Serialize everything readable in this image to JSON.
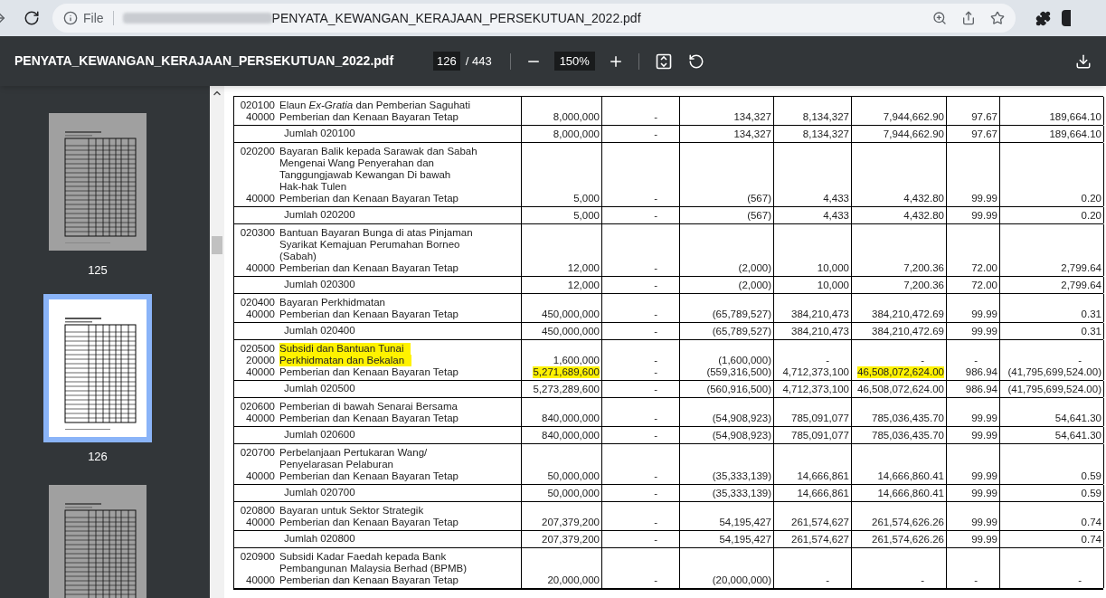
{
  "browser": {
    "scheme": "File",
    "file_name": "PENYATA_KEWANGAN_KERAJAAN_PERSEKUTUAN_2022.pdf"
  },
  "pdf_toolbar": {
    "title": "PENYATA_KEWANGAN_KERAJAAN_PERSEKUTUAN_2022.pdf",
    "page": "126",
    "page_count": "/ 443",
    "zoom": "150%"
  },
  "thumbnails": [
    {
      "label": "125",
      "selected": false
    },
    {
      "label": "126",
      "selected": true
    },
    {
      "selected": false
    }
  ],
  "groups": [
    {
      "rows": [
        {
          "code": "020100",
          "lines": [
            "Elaun *Ex-Gratia* dan Pemberian Saguhati"
          ],
          "highlighted": false
        },
        {
          "code": "40000",
          "lines": [
            "Pemberian dan Kenaan Bayaran Tetap"
          ],
          "highlighted": false,
          "values": [
            "8,000,000",
            "-",
            "134,327",
            "8,134,327",
            "7,944,662.90",
            "97.67",
            "189,664.10"
          ],
          "cell_highlights": [
            false,
            false,
            false,
            false,
            false,
            false,
            false
          ]
        }
      ],
      "total": {
        "label": "Jumlah 020100",
        "values": [
          "8,000,000",
          "-",
          "134,327",
          "8,134,327",
          "7,944,662.90",
          "97.67",
          "189,664.10"
        ]
      }
    },
    {
      "rows": [
        {
          "code": "020200",
          "lines": [
            "Bayaran Balik kepada Sarawak dan Sabah",
            "Mengenai Wang Penyerahan dan",
            "Tanggungjawab Kewangan Di bawah",
            "Hak-hak Tulen"
          ],
          "highlighted": false
        },
        {
          "code": "40000",
          "lines": [
            "Pemberian dan Kenaan Bayaran Tetap"
          ],
          "highlighted": false,
          "values": [
            "5,000",
            "-",
            "(567)",
            "4,433",
            "4,432.80",
            "99.99",
            "0.20"
          ],
          "cell_highlights": [
            false,
            false,
            false,
            false,
            false,
            false,
            false
          ]
        }
      ],
      "total": {
        "label": "Jumlah 020200",
        "values": [
          "5,000",
          "-",
          "(567)",
          "4,433",
          "4,432.80",
          "99.99",
          "0.20"
        ]
      }
    },
    {
      "rows": [
        {
          "code": "020300",
          "lines": [
            "Bantuan Bayaran Bunga di atas Pinjaman",
            "Syarikat Kemajuan Perumahan Borneo",
            "(Sabah)"
          ],
          "highlighted": false
        },
        {
          "code": "40000",
          "lines": [
            "Pemberian dan Kenaan Bayaran Tetap"
          ],
          "highlighted": false,
          "values": [
            "12,000",
            "-",
            "(2,000)",
            "10,000",
            "7,200.36",
            "72.00",
            "2,799.64"
          ],
          "cell_highlights": [
            false,
            false,
            false,
            false,
            false,
            false,
            false
          ]
        }
      ],
      "total": {
        "label": "Jumlah 020300",
        "values": [
          "12,000",
          "-",
          "(2,000)",
          "10,000",
          "7,200.36",
          "72.00",
          "2,799.64"
        ]
      }
    },
    {
      "rows": [
        {
          "code": "020400",
          "lines": [
            "Bayaran Perkhidmatan"
          ],
          "highlighted": false
        },
        {
          "code": "40000",
          "lines": [
            "Pemberian dan Kenaan Bayaran Tetap"
          ],
          "highlighted": false,
          "values": [
            "450,000,000",
            "-",
            "(65,789,527)",
            "384,210,473",
            "384,210,472.69",
            "99.99",
            "0.31"
          ],
          "cell_highlights": [
            false,
            false,
            false,
            false,
            false,
            false,
            false
          ]
        }
      ],
      "total": {
        "label": "Jumlah 020400",
        "values": [
          "450,000,000",
          "-",
          "(65,789,527)",
          "384,210,473",
          "384,210,472.69",
          "99.99",
          "0.31"
        ]
      }
    },
    {
      "rows": [
        {
          "code": "020500",
          "lines": [
            "Subsidi dan Bantuan Tunai"
          ],
          "highlighted": true
        },
        {
          "code": "20000",
          "lines": [
            "Perkhidmatan dan Bekalan"
          ],
          "highlighted": true,
          "values": [
            "1,600,000",
            "-",
            "(1,600,000)",
            "-",
            "-",
            "-",
            "-"
          ],
          "cell_highlights": [
            false,
            false,
            false,
            false,
            false,
            false,
            false
          ]
        },
        {
          "code": "40000",
          "lines": [
            "Pemberian dan Kenaan Bayaran Tetap"
          ],
          "highlighted": false,
          "values": [
            "5,271,689,600",
            "-",
            "(559,316,500)",
            "4,712,373,100",
            "46,508,072,624.00",
            "986.94",
            "(41,795,699,524.00)"
          ],
          "cell_highlights": [
            true,
            false,
            false,
            false,
            true,
            false,
            false
          ]
        }
      ],
      "total": {
        "label": "Jumlah 020500",
        "values": [
          "5,273,289,600",
          "-",
          "(560,916,500)",
          "4,712,373,100",
          "46,508,072,624.00",
          "986.94",
          "(41,795,699,524.00)"
        ]
      }
    },
    {
      "rows": [
        {
          "code": "020600",
          "lines": [
            "Pemberian di bawah Senarai Bersama"
          ],
          "highlighted": false
        },
        {
          "code": "40000",
          "lines": [
            "Pemberian dan Kenaan Bayaran Tetap"
          ],
          "highlighted": false,
          "values": [
            "840,000,000",
            "-",
            "(54,908,923)",
            "785,091,077",
            "785,036,435.70",
            "99.99",
            "54,641.30"
          ],
          "cell_highlights": [
            false,
            false,
            false,
            false,
            false,
            false,
            false
          ]
        }
      ],
      "total": {
        "label": "Jumlah 020600",
        "values": [
          "840,000,000",
          "-",
          "(54,908,923)",
          "785,091,077",
          "785,036,435.70",
          "99.99",
          "54,641.30"
        ]
      }
    },
    {
      "rows": [
        {
          "code": "020700",
          "lines": [
            "Perbelanjaan Pertukaran Wang/",
            "Penyelarasan Pelaburan"
          ],
          "highlighted": false
        },
        {
          "code": "40000",
          "lines": [
            "Pemberian dan Kenaan Bayaran Tetap"
          ],
          "highlighted": false,
          "values": [
            "50,000,000",
            "-",
            "(35,333,139)",
            "14,666,861",
            "14,666,860.41",
            "99.99",
            "0.59"
          ],
          "cell_highlights": [
            false,
            false,
            false,
            false,
            false,
            false,
            false
          ]
        }
      ],
      "total": {
        "label": "Jumlah 020700",
        "values": [
          "50,000,000",
          "-",
          "(35,333,139)",
          "14,666,861",
          "14,666,860.41",
          "99.99",
          "0.59"
        ]
      }
    },
    {
      "rows": [
        {
          "code": "020800",
          "lines": [
            "Bayaran untuk Sektor Strategik"
          ],
          "highlighted": false
        },
        {
          "code": "40000",
          "lines": [
            "Pemberian dan Kenaan Bayaran Tetap"
          ],
          "highlighted": false,
          "values": [
            "207,379,200",
            "-",
            "54,195,427",
            "261,574,627",
            "261,574,626.26",
            "99.99",
            "0.74"
          ],
          "cell_highlights": [
            false,
            false,
            false,
            false,
            false,
            false,
            false
          ]
        }
      ],
      "total": {
        "label": "Jumlah 020800",
        "values": [
          "207,379,200",
          "-",
          "54,195,427",
          "261,574,627",
          "261,574,626.26",
          "99.99",
          "0.74"
        ]
      }
    },
    {
      "rows": [
        {
          "code": "020900",
          "lines": [
            "Subsidi Kadar Faedah kepada Bank",
            "Pembangunan Malaysia Berhad (BPMB)"
          ],
          "highlighted": false
        },
        {
          "code": "40000",
          "lines": [
            "Pemberian dan Kenaan Bayaran Tetap"
          ],
          "highlighted": false,
          "values": [
            "20,000,000",
            "-",
            "(20,000,000)",
            "-",
            "-",
            "-",
            "-"
          ],
          "cell_highlights": [
            false,
            false,
            false,
            false,
            false,
            false,
            false
          ]
        }
      ]
    }
  ]
}
